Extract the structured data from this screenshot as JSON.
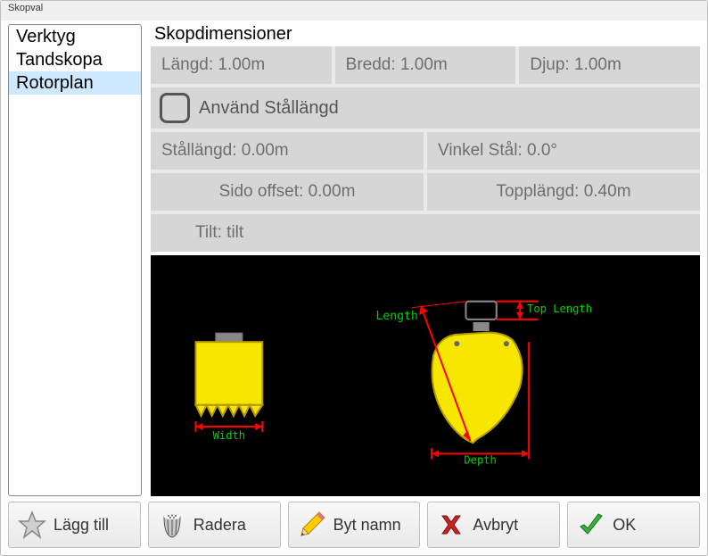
{
  "window": {
    "title": "Skopval"
  },
  "sidebar": {
    "items": [
      {
        "label": "Verktyg",
        "selected": false
      },
      {
        "label": "Tandskopa",
        "selected": false
      },
      {
        "label": "Rotorplan",
        "selected": true
      }
    ]
  },
  "section": {
    "title": "Skopdimensioner"
  },
  "dimensions": {
    "length": "Längd: 1.00m",
    "width": "Bredd: 1.00m",
    "depth": "Djup: 1.00m",
    "use_steel_length_label": "Använd Stållängd",
    "steel_length": "Stållängd: 0.00m",
    "steel_angle": "Vinkel Stål: 0.0°",
    "side_offset": "Sido offset: 0.00m",
    "top_length": "Topplängd: 0.40m",
    "tilt": "Tilt: tilt"
  },
  "diagram_labels": {
    "length": "Length",
    "top_length": "Top Length",
    "width": "Width",
    "depth": "Depth"
  },
  "buttons": {
    "add": "Lägg till",
    "delete": "Radera",
    "rename": "Byt namn",
    "cancel": "Avbryt",
    "ok": "OK"
  }
}
